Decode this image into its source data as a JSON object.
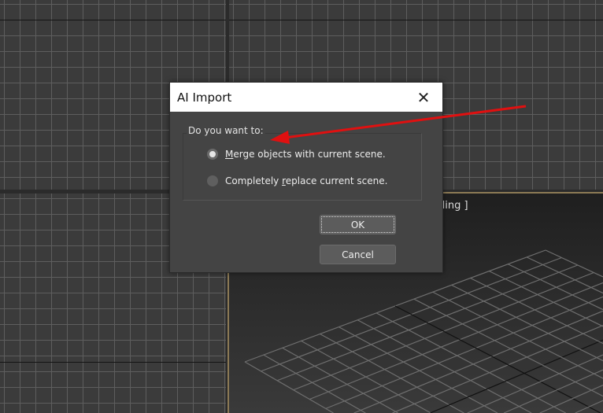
{
  "dialog": {
    "title": "AI Import",
    "close_icon": "close-icon",
    "group_label": "Do you want to:",
    "options": [
      {
        "pre": "",
        "accel": "M",
        "post": "erge objects with current scene.",
        "selected": true
      },
      {
        "pre": "Completely ",
        "accel": "r",
        "post": "eplace current scene.",
        "selected": false
      }
    ],
    "ok_label": "OK",
    "cancel_label": "Cancel"
  },
  "viewport": {
    "label_fragment": "ading ]"
  },
  "colors": {
    "arrow": "#e01010",
    "active_border": "#8c7a55"
  }
}
